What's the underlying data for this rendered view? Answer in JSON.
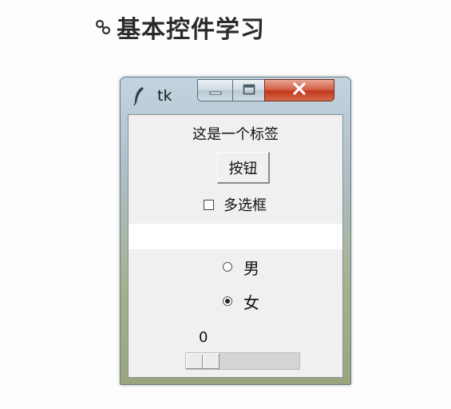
{
  "slide": {
    "title": "基本控件学习",
    "bullet_icon": "link-icon"
  },
  "window": {
    "title": "tk",
    "app_icon": "feather-icon",
    "minimize_icon": "minimize-icon",
    "maximize_icon": "maximize-icon",
    "close_icon": "close-icon",
    "close_color": "#d04a2c"
  },
  "widgets": {
    "label": "这是一个标签",
    "button": "按钮",
    "checkbox": {
      "label": "多选框",
      "checked": false
    },
    "entry": {
      "value": ""
    },
    "radios": [
      {
        "label": "男",
        "checked": false
      },
      {
        "label": "女",
        "checked": true
      }
    ],
    "scale": {
      "value": "0",
      "level": 0
    }
  }
}
